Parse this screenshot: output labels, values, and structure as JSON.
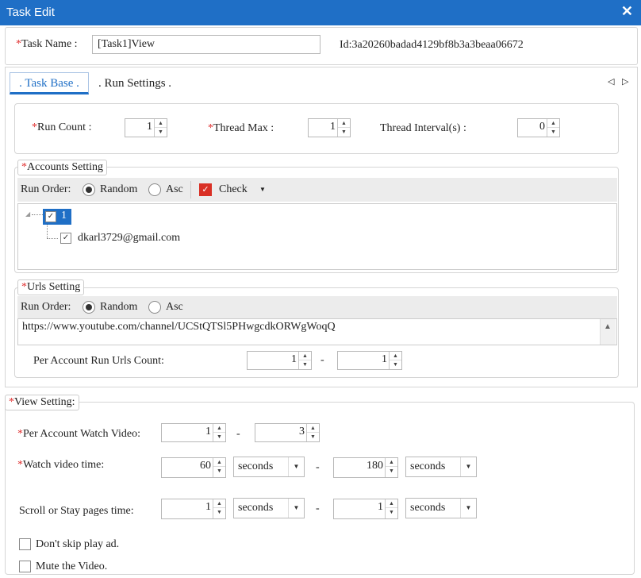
{
  "window": {
    "title": "Task Edit"
  },
  "task": {
    "name_label": "Task Name :",
    "name_value": "[Task1]View",
    "id_text": "Id:3a20260badad4129bf8b3a3beaa06672"
  },
  "tabs": [
    {
      "label": ". Task Base ."
    },
    {
      "label": ". Run Settings ."
    }
  ],
  "base": {
    "run_count_label": "Run Count :",
    "run_count": "1",
    "thread_max_label": "Thread Max :",
    "thread_max": "1",
    "thread_interval_label": "Thread  Interval(s) :",
    "thread_interval": "0"
  },
  "accounts": {
    "legend": "Accounts Setting",
    "run_order_label": "Run Order:",
    "opt_random": "Random",
    "opt_asc": "Asc",
    "check_label": "Check",
    "tree_root": "1",
    "tree_child": "dkarl3729@gmail.com"
  },
  "urls": {
    "legend": "Urls Setting",
    "run_order_label": "Run Order:",
    "opt_random": "Random",
    "opt_asc": "Asc",
    "url": "https://www.youtube.com/channel/UCStQTSl5PHwgcdkORWgWoqQ",
    "per_account_label": "Per Account Run Urls Count:",
    "min": "1",
    "dash": "-",
    "max": "1"
  },
  "view": {
    "legend": "View Setting:",
    "watch_video_label": "Per Account Watch Video:",
    "watch_min": "1",
    "watch_max": "3",
    "watch_time_label": "Watch video time:",
    "time_min": "60",
    "time_min_unit": "seconds",
    "time_max": "180",
    "time_max_unit": "seconds",
    "scroll_label": "Scroll or Stay pages time:",
    "scroll_min": "1",
    "scroll_min_unit": "seconds",
    "scroll_max": "1",
    "scroll_max_unit": "seconds",
    "dash": "-",
    "skip_ad_label": "Don't skip play ad.",
    "mute_label": "Mute the Video."
  },
  "colors": {
    "titlebar": "#1f6fc6",
    "required": "#e03131",
    "check_red": "#d93025",
    "tab_active": "#1f6fc6"
  }
}
